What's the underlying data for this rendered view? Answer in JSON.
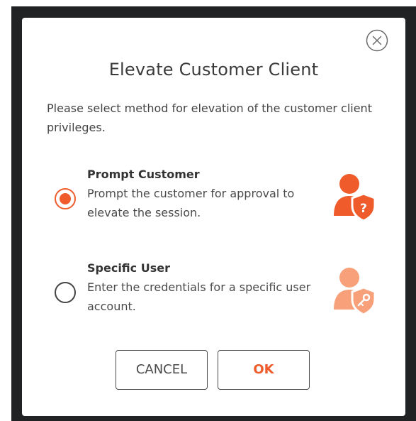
{
  "dialog": {
    "title": "Elevate Customer Client",
    "description": "Please select method for elevation of the customer client privileges.",
    "close_icon": "close-circle-icon"
  },
  "options": [
    {
      "title": "Prompt Customer",
      "description": "Prompt the customer for approval to elevate the session.",
      "selected": true,
      "icon": "user-shield-question-icon",
      "icon_color": "#ef5b2b"
    },
    {
      "title": "Specific User",
      "description": "Enter the credentials for a specific user account.",
      "selected": false,
      "icon": "user-shield-key-icon",
      "icon_color": "#f7a07a"
    }
  ],
  "buttons": {
    "cancel_label": "CANCEL",
    "ok_label": "OK"
  },
  "colors": {
    "accent": "#ef5b2b",
    "accent_light": "#f7a07a",
    "backdrop": "#202224",
    "text": "#3b3b3b"
  }
}
